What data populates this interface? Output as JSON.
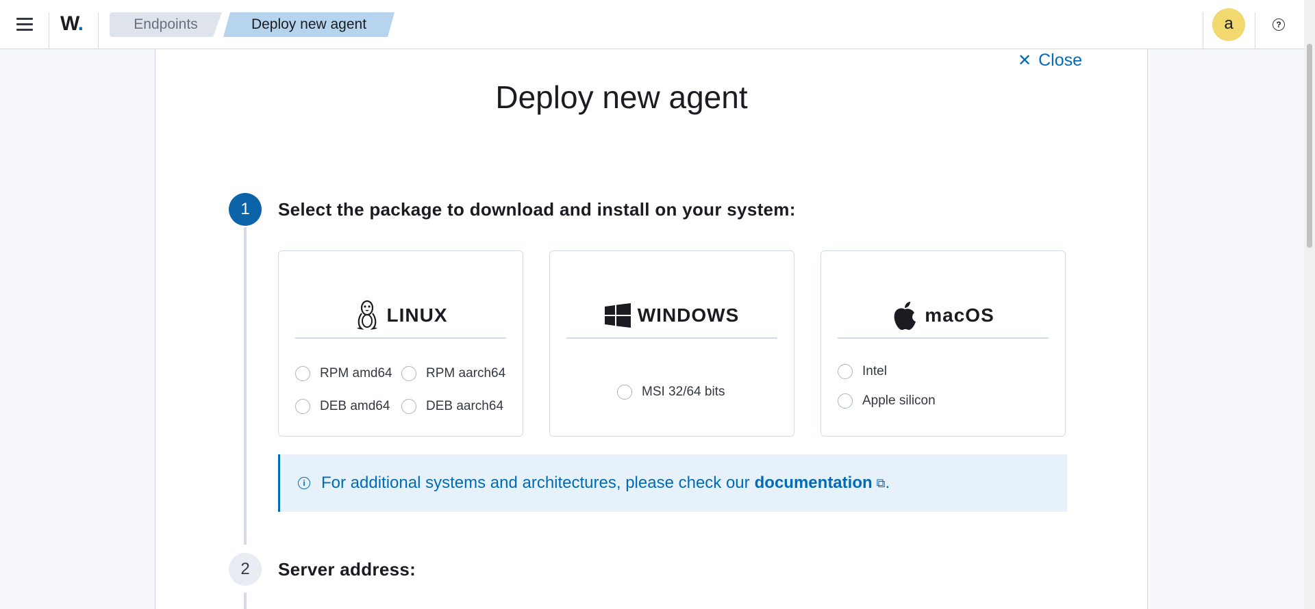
{
  "header": {
    "logo_letter": "W",
    "logo_dot": ".",
    "breadcrumbs": [
      {
        "label": "Endpoints"
      },
      {
        "label": "Deploy new agent"
      }
    ],
    "avatar_initial": "a",
    "help_glyph": "?"
  },
  "panel": {
    "close_label": "Close",
    "title": "Deploy new agent",
    "steps": [
      {
        "number": "1",
        "title": "Select the package to download and install on your system:"
      },
      {
        "number": "2",
        "title": "Server address:"
      }
    ],
    "os_cards": [
      {
        "name": "LINUX",
        "icon": "linux-penguin-icon",
        "options": [
          "RPM amd64",
          "RPM aarch64",
          "DEB amd64",
          "DEB aarch64"
        ]
      },
      {
        "name": "WINDOWS",
        "icon": "windows-logo-icon",
        "options": [
          "MSI 32/64 bits"
        ]
      },
      {
        "name": "macOS",
        "icon": "apple-logo-icon",
        "options": [
          "Intel",
          "Apple silicon"
        ]
      }
    ],
    "callout": {
      "text": "For additional systems and architectures, please check our",
      "link_label": "documentation",
      "suffix": "."
    }
  },
  "colors": {
    "accent": "#006bb8",
    "step_active": "#0b64a8",
    "avatar_bg": "#f1d86f",
    "callout_bg": "#e6f1fa"
  }
}
